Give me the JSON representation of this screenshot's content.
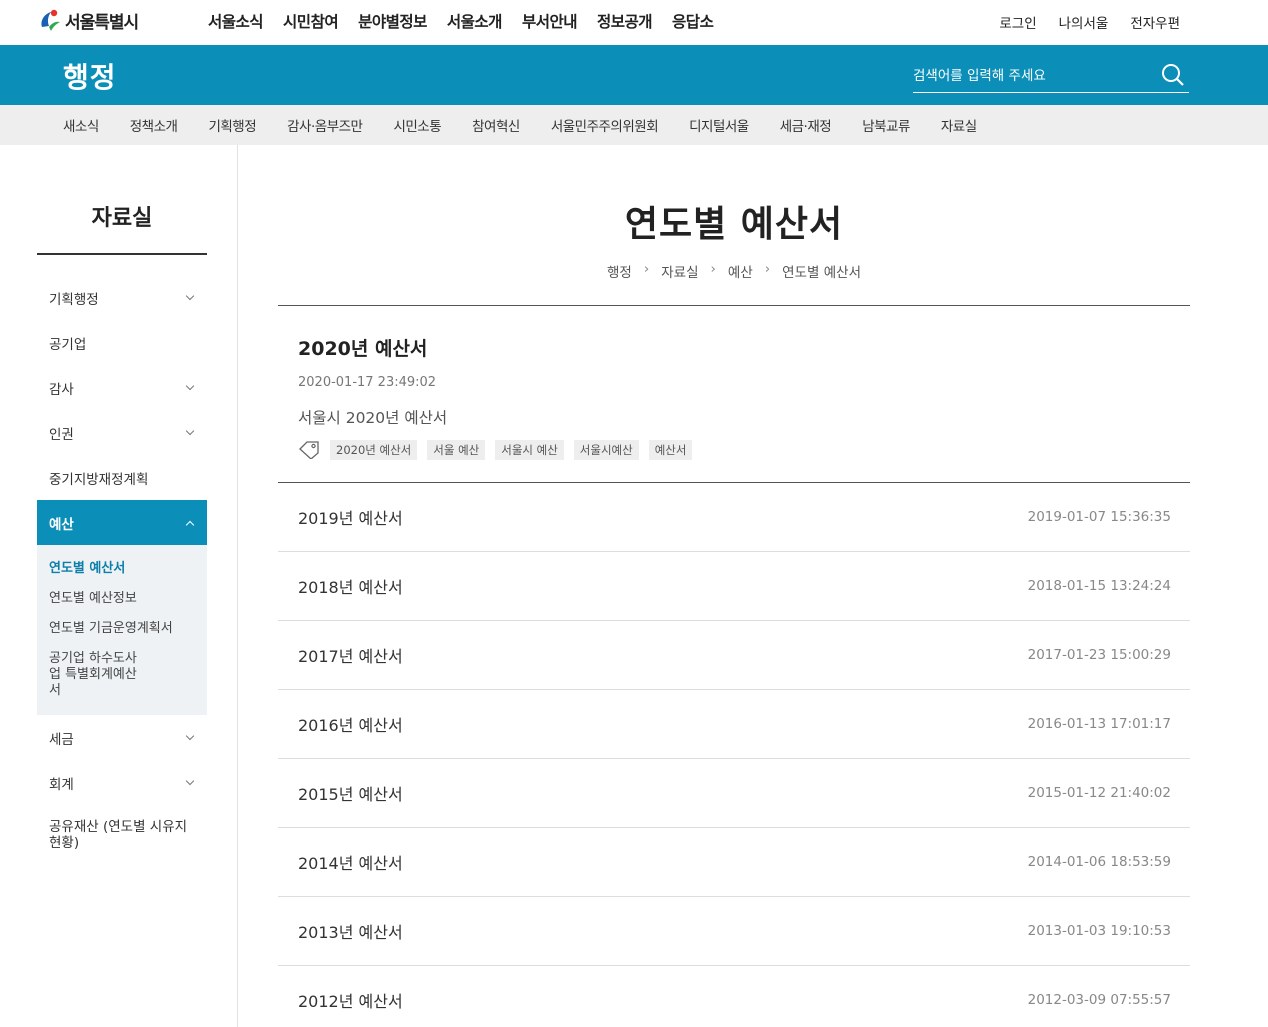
{
  "header": {
    "logo_text": "서울특별시",
    "gnb": [
      "서울소식",
      "시민참여",
      "분야별정보",
      "서울소개",
      "부서안내",
      "정보공개",
      "응답소"
    ],
    "util": [
      "로그인",
      "나의서울",
      "전자우편"
    ]
  },
  "banner": {
    "title": "행정",
    "search_placeholder": "검색어를 입력해 주세요"
  },
  "subnav": [
    "새소식",
    "정책소개",
    "기획행정",
    "감사·옴부즈만",
    "시민소통",
    "참여혁신",
    "서울민주주의위원회",
    "디지털서울",
    "세금·재정",
    "남북교류",
    "자료실"
  ],
  "sidebar": {
    "title": "자료실",
    "items": [
      {
        "label": "기획행정",
        "expandable": true
      },
      {
        "label": "공기업",
        "expandable": false
      },
      {
        "label": "감사",
        "expandable": true
      },
      {
        "label": "인권",
        "expandable": true
      },
      {
        "label": "중기지방재정계획",
        "expandable": false
      },
      {
        "label": "예산",
        "expandable": true,
        "active": true
      },
      {
        "label": "세금",
        "expandable": true
      },
      {
        "label": "회계",
        "expandable": true
      },
      {
        "label": "공유재산 (연도별 시유지 현황)",
        "expandable": false
      }
    ],
    "sub_items": [
      "연도별 예산서",
      "연도별 예산정보",
      "연도별 기금운영계획서",
      "공기업 하수도사업 특별회계예산서"
    ]
  },
  "main": {
    "page_title": "연도별 예산서",
    "breadcrumb": [
      "행정",
      "자료실",
      "예산",
      "연도별 예산서"
    ],
    "featured": {
      "title": "2020년 예산서",
      "date": "2020-01-17 23:49:02",
      "desc": "서울시 2020년 예산서",
      "tags": [
        "2020년 예산서",
        "서울 예산",
        "서울시 예산",
        "서울시예산",
        "예산서"
      ]
    },
    "rows": [
      {
        "title": "2019년 예산서",
        "date": "2019-01-07 15:36:35"
      },
      {
        "title": "2018년 예산서",
        "date": "2018-01-15 13:24:24"
      },
      {
        "title": "2017년 예산서",
        "date": "2017-01-23 15:00:29"
      },
      {
        "title": "2016년 예산서",
        "date": "2016-01-13 17:01:17"
      },
      {
        "title": "2015년 예산서",
        "date": "2015-01-12 21:40:02"
      },
      {
        "title": "2014년 예산서",
        "date": "2014-01-06 18:53:59"
      },
      {
        "title": "2013년 예산서",
        "date": "2013-01-03 19:10:53"
      },
      {
        "title": "2012년 예산서",
        "date": "2012-03-09 07:55:57"
      }
    ]
  },
  "colors": {
    "brand": "#0b8fb8",
    "active_sub": "#0b7fa8"
  }
}
